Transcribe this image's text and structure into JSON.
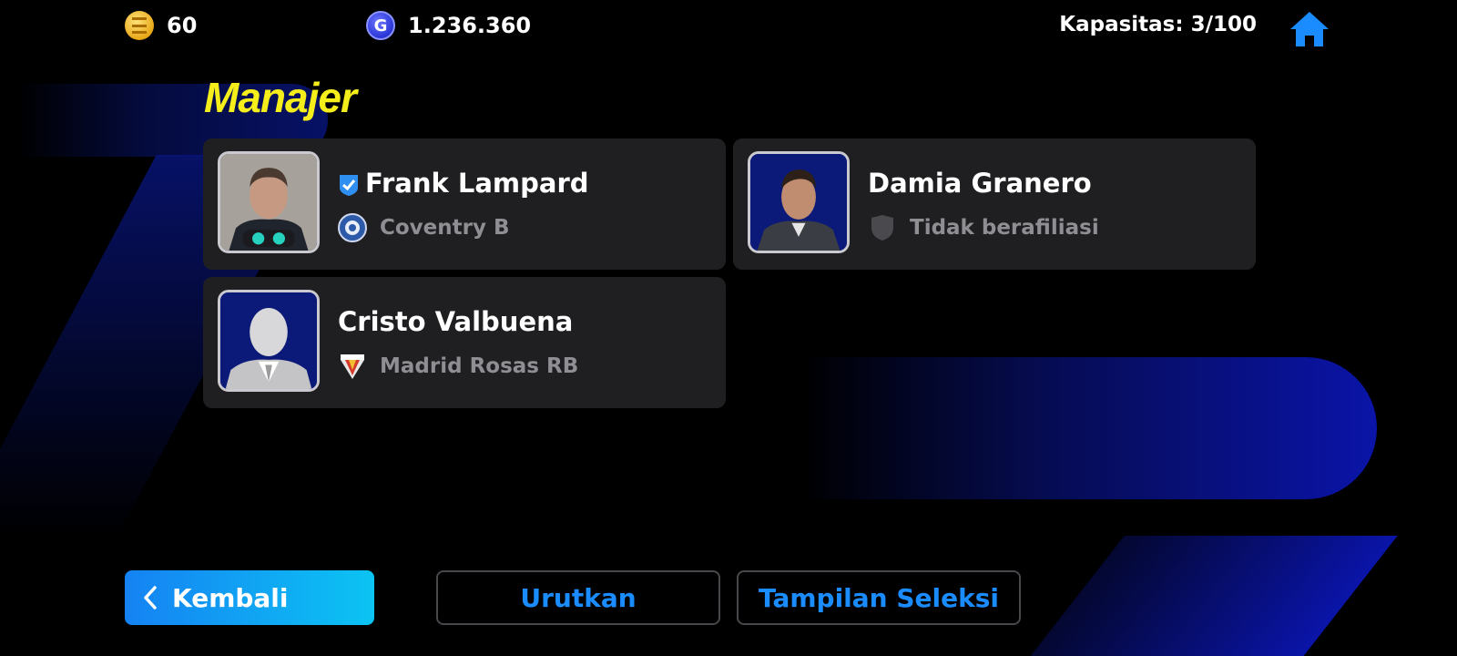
{
  "currency": {
    "coins": "60",
    "gp": "1.236.360"
  },
  "capacity_label": "Kapasitas: 3/100",
  "page_title": "Manajer",
  "managers": [
    {
      "name": "Frank Lampard",
      "club": "Coventry B",
      "verified": true
    },
    {
      "name": "Damia Granero",
      "club": "Tidak berafiliasi",
      "verified": false
    },
    {
      "name": "Cristo Valbuena",
      "club": "Madrid Rosas RB",
      "verified": false
    }
  ],
  "buttons": {
    "back": "Kembali",
    "sort": "Urutkan",
    "selection_view": "Tampilan Seleksi"
  },
  "icons": {
    "coin": "efootball-coin-icon",
    "gp": "gp-icon",
    "home": "home-icon",
    "back": "chevron-left-icon",
    "verified": "verified-check-icon"
  },
  "colors": {
    "title": "#f5ee1a",
    "accent": "#1a8cff",
    "card_bg": "#1f1f22"
  }
}
